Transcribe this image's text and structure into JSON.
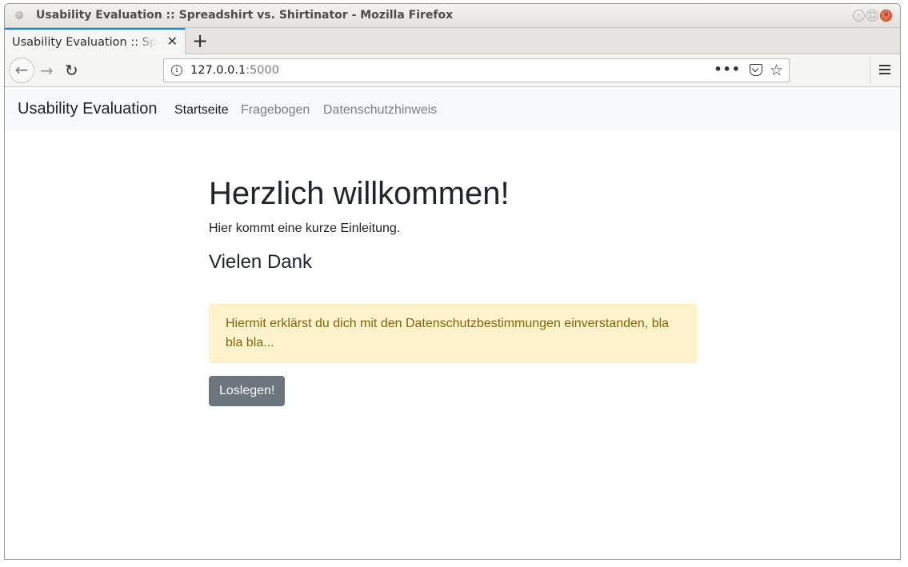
{
  "window": {
    "title": "Usability Evaluation :: Spreadshirt vs. Shirtinator - Mozilla Firefox",
    "controls": {
      "minimize": "–",
      "maximize": "□",
      "close": "✕"
    }
  },
  "tabs": [
    {
      "title": "Usability Evaluation :: Spreadshirt vs. Shirtinator",
      "close": "✕",
      "active": true
    }
  ],
  "new_tab_label": "+",
  "toolbar": {
    "back": "←",
    "forward": "→",
    "reload": "↻",
    "info": "i",
    "url_host": "127.0.0.1",
    "url_port": ":5000",
    "page_actions": "•••",
    "bookmark": "☆"
  },
  "site": {
    "brand": "Usability Evaluation",
    "nav": [
      {
        "label": "Startseite",
        "active": true
      },
      {
        "label": "Fragebogen",
        "active": false
      },
      {
        "label": "Datenschutzhinweis",
        "active": false
      }
    ]
  },
  "main": {
    "heading": "Herzlich willkommen!",
    "intro": "Hier kommt eine kurze Einleitung.",
    "subheading": "Vielen Dank",
    "alert": "Hiermit erklärst du dich mit den Datenschutzbestimmungen einverstanden, bla bla bla...",
    "button": "Loslegen!"
  },
  "colors": {
    "tab_accent": "#0a84ff",
    "alert_bg": "#fff3cd",
    "alert_text": "#856404",
    "button_bg": "#6c757d",
    "close_button": "#dc4a1c"
  }
}
